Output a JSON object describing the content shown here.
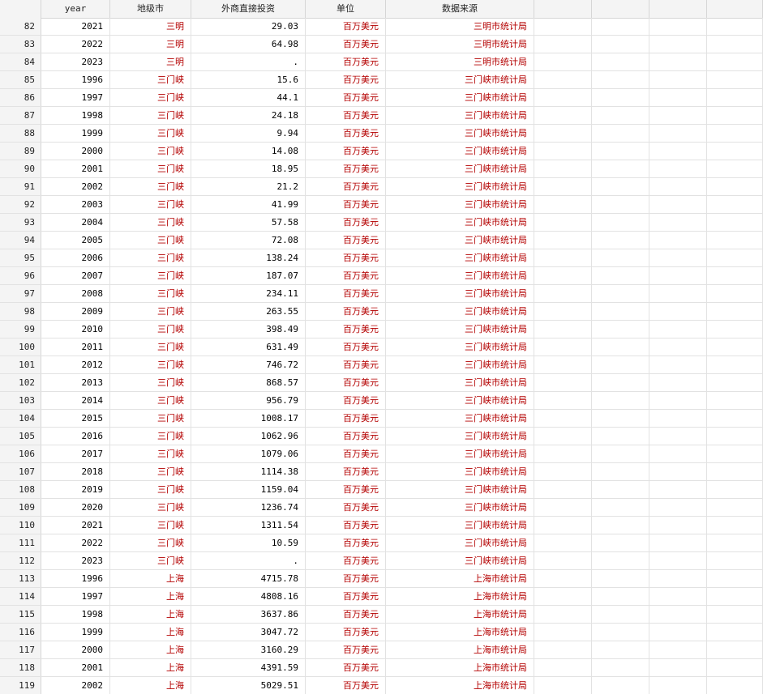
{
  "table": {
    "columns": [
      "",
      "year",
      "地级市",
      "外商直接投资",
      "单位",
      "数据来源"
    ],
    "rows": [
      {
        "n": "82",
        "year": "2021",
        "city": "三明",
        "fdi": "29.03",
        "unit": "百万美元",
        "source": "三明市统计局"
      },
      {
        "n": "83",
        "year": "2022",
        "city": "三明",
        "fdi": "64.98",
        "unit": "百万美元",
        "source": "三明市统计局"
      },
      {
        "n": "84",
        "year": "2023",
        "city": "三明",
        "fdi": ".",
        "unit": "百万美元",
        "source": "三明市统计局"
      },
      {
        "n": "85",
        "year": "1996",
        "city": "三门峡",
        "fdi": "15.6",
        "unit": "百万美元",
        "source": "三门峡市统计局"
      },
      {
        "n": "86",
        "year": "1997",
        "city": "三门峡",
        "fdi": "44.1",
        "unit": "百万美元",
        "source": "三门峡市统计局"
      },
      {
        "n": "87",
        "year": "1998",
        "city": "三门峡",
        "fdi": "24.18",
        "unit": "百万美元",
        "source": "三门峡市统计局"
      },
      {
        "n": "88",
        "year": "1999",
        "city": "三门峡",
        "fdi": "9.94",
        "unit": "百万美元",
        "source": "三门峡市统计局"
      },
      {
        "n": "89",
        "year": "2000",
        "city": "三门峡",
        "fdi": "14.08",
        "unit": "百万美元",
        "source": "三门峡市统计局"
      },
      {
        "n": "90",
        "year": "2001",
        "city": "三门峡",
        "fdi": "18.95",
        "unit": "百万美元",
        "source": "三门峡市统计局"
      },
      {
        "n": "91",
        "year": "2002",
        "city": "三门峡",
        "fdi": "21.2",
        "unit": "百万美元",
        "source": "三门峡市统计局"
      },
      {
        "n": "92",
        "year": "2003",
        "city": "三门峡",
        "fdi": "41.99",
        "unit": "百万美元",
        "source": "三门峡市统计局"
      },
      {
        "n": "93",
        "year": "2004",
        "city": "三门峡",
        "fdi": "57.58",
        "unit": "百万美元",
        "source": "三门峡市统计局"
      },
      {
        "n": "94",
        "year": "2005",
        "city": "三门峡",
        "fdi": "72.08",
        "unit": "百万美元",
        "source": "三门峡市统计局"
      },
      {
        "n": "95",
        "year": "2006",
        "city": "三门峡",
        "fdi": "138.24",
        "unit": "百万美元",
        "source": "三门峡市统计局"
      },
      {
        "n": "96",
        "year": "2007",
        "city": "三门峡",
        "fdi": "187.07",
        "unit": "百万美元",
        "source": "三门峡市统计局"
      },
      {
        "n": "97",
        "year": "2008",
        "city": "三门峡",
        "fdi": "234.11",
        "unit": "百万美元",
        "source": "三门峡市统计局"
      },
      {
        "n": "98",
        "year": "2009",
        "city": "三门峡",
        "fdi": "263.55",
        "unit": "百万美元",
        "source": "三门峡市统计局"
      },
      {
        "n": "99",
        "year": "2010",
        "city": "三门峡",
        "fdi": "398.49",
        "unit": "百万美元",
        "source": "三门峡市统计局"
      },
      {
        "n": "100",
        "year": "2011",
        "city": "三门峡",
        "fdi": "631.49",
        "unit": "百万美元",
        "source": "三门峡市统计局"
      },
      {
        "n": "101",
        "year": "2012",
        "city": "三门峡",
        "fdi": "746.72",
        "unit": "百万美元",
        "source": "三门峡市统计局"
      },
      {
        "n": "102",
        "year": "2013",
        "city": "三门峡",
        "fdi": "868.57",
        "unit": "百万美元",
        "source": "三门峡市统计局"
      },
      {
        "n": "103",
        "year": "2014",
        "city": "三门峡",
        "fdi": "956.79",
        "unit": "百万美元",
        "source": "三门峡市统计局"
      },
      {
        "n": "104",
        "year": "2015",
        "city": "三门峡",
        "fdi": "1008.17",
        "unit": "百万美元",
        "source": "三门峡市统计局"
      },
      {
        "n": "105",
        "year": "2016",
        "city": "三门峡",
        "fdi": "1062.96",
        "unit": "百万美元",
        "source": "三门峡市统计局"
      },
      {
        "n": "106",
        "year": "2017",
        "city": "三门峡",
        "fdi": "1079.06",
        "unit": "百万美元",
        "source": "三门峡市统计局"
      },
      {
        "n": "107",
        "year": "2018",
        "city": "三门峡",
        "fdi": "1114.38",
        "unit": "百万美元",
        "source": "三门峡市统计局"
      },
      {
        "n": "108",
        "year": "2019",
        "city": "三门峡",
        "fdi": "1159.04",
        "unit": "百万美元",
        "source": "三门峡市统计局"
      },
      {
        "n": "109",
        "year": "2020",
        "city": "三门峡",
        "fdi": "1236.74",
        "unit": "百万美元",
        "source": "三门峡市统计局"
      },
      {
        "n": "110",
        "year": "2021",
        "city": "三门峡",
        "fdi": "1311.54",
        "unit": "百万美元",
        "source": "三门峡市统计局"
      },
      {
        "n": "111",
        "year": "2022",
        "city": "三门峡",
        "fdi": "10.59",
        "unit": "百万美元",
        "source": "三门峡市统计局"
      },
      {
        "n": "112",
        "year": "2023",
        "city": "三门峡",
        "fdi": ".",
        "unit": "百万美元",
        "source": "三门峡市统计局"
      },
      {
        "n": "113",
        "year": "1996",
        "city": "上海",
        "fdi": "4715.78",
        "unit": "百万美元",
        "source": "上海市统计局"
      },
      {
        "n": "114",
        "year": "1997",
        "city": "上海",
        "fdi": "4808.16",
        "unit": "百万美元",
        "source": "上海市统计局"
      },
      {
        "n": "115",
        "year": "1998",
        "city": "上海",
        "fdi": "3637.86",
        "unit": "百万美元",
        "source": "上海市统计局"
      },
      {
        "n": "116",
        "year": "1999",
        "city": "上海",
        "fdi": "3047.72",
        "unit": "百万美元",
        "source": "上海市统计局"
      },
      {
        "n": "117",
        "year": "2000",
        "city": "上海",
        "fdi": "3160.29",
        "unit": "百万美元",
        "source": "上海市统计局"
      },
      {
        "n": "118",
        "year": "2001",
        "city": "上海",
        "fdi": "4391.59",
        "unit": "百万美元",
        "source": "上海市统计局"
      },
      {
        "n": "119",
        "year": "2002",
        "city": "上海",
        "fdi": "5029.51",
        "unit": "百万美元",
        "source": "上海市统计局"
      }
    ]
  }
}
